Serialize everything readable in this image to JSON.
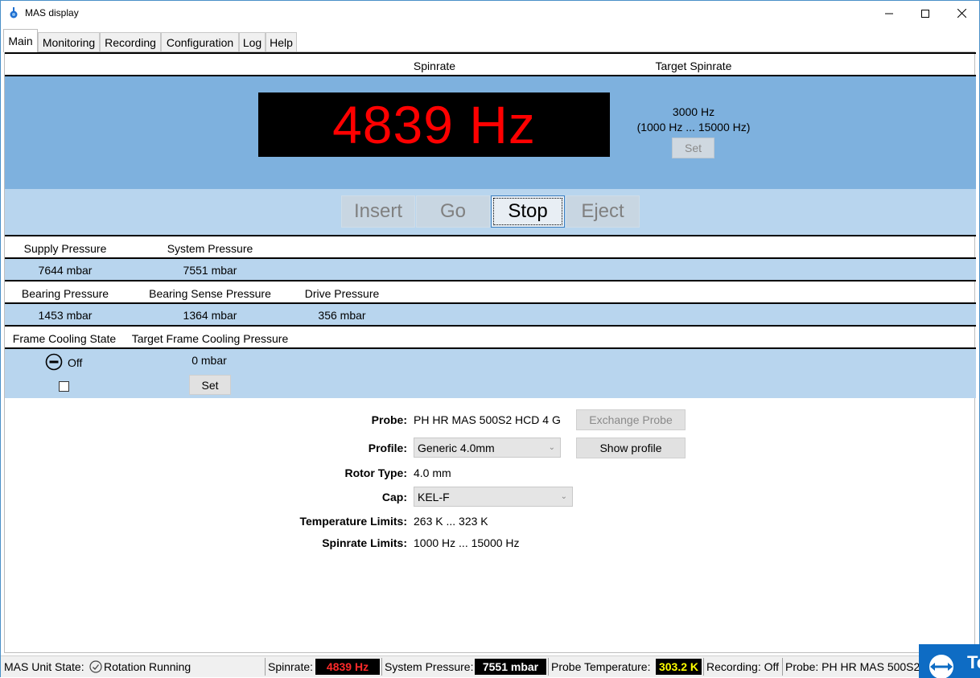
{
  "window": {
    "title": "MAS display"
  },
  "window_controls": {
    "minimize": "─",
    "maximize": "☐",
    "close": "✕"
  },
  "tabs": [
    {
      "label": "Main"
    },
    {
      "label": "Monitoring"
    },
    {
      "label": "Recording"
    },
    {
      "label": "Configuration"
    },
    {
      "label": "Log"
    },
    {
      "label": "Help"
    }
  ],
  "spinrate": {
    "header": "Spinrate",
    "target_header": "Target Spinrate",
    "value": "4839 Hz",
    "target_value": "3000 Hz",
    "target_range": "(1000 Hz ... 15000 Hz)",
    "set_label": "Set"
  },
  "motor_buttons": [
    {
      "label": "Insert",
      "state": "disabled"
    },
    {
      "label": "Go",
      "state": "disabled"
    },
    {
      "label": "Stop",
      "state": "active"
    },
    {
      "label": "Eject",
      "state": "disabled"
    }
  ],
  "pressures_row1": {
    "supply_label": "Supply Pressure",
    "supply_value": "7644 mbar",
    "system_label": "System Pressure",
    "system_value": "7551 mbar"
  },
  "pressures_row2": {
    "bearing_label": "Bearing Pressure",
    "bearing_value": "1453 mbar",
    "bearing_sense_label": "Bearing Sense Pressure",
    "bearing_sense_value": "1364 mbar",
    "drive_label": "Drive Pressure",
    "drive_value": "356 mbar"
  },
  "frame_cooling": {
    "state_label": "Frame Cooling State",
    "state_value": "Off",
    "target_label": "Target Frame Cooling Pressure",
    "target_value": "0 mbar",
    "set_label": "Set",
    "checkbox_checked": false
  },
  "probe_info": {
    "probe_label": "Probe:",
    "probe_value": "PH HR MAS 500S2 HCD 4 G",
    "exchange_button": "Exchange Probe",
    "profile_label": "Profile:",
    "profile_value": "Generic 4.0mm",
    "show_profile_button": "Show profile",
    "rotor_label": "Rotor Type:",
    "rotor_value": "4.0 mm",
    "cap_label": "Cap:",
    "cap_value": "KEL-F",
    "temp_label": "Temperature Limits:",
    "temp_value": "263 K ... 323 K",
    "spin_label": "Spinrate Limits:",
    "spin_value": "1000 Hz ... 15000 Hz"
  },
  "statusbar": {
    "unit_state_label": "MAS Unit State:",
    "unit_state_value": "Rotation Running",
    "spinrate_label": "Spinrate:",
    "spinrate_value": "4839 Hz",
    "system_pressure_label": "System Pressure:",
    "system_pressure_value": "7551 mbar",
    "probe_temp_label": "Probe Temperature:",
    "probe_temp_value": "303.2 K",
    "recording_label": "Recording: Off",
    "probe_label": "Probe: PH HR MAS 500S2",
    "colors": {
      "spinrate": "#ff2a2a",
      "pressure": "#ffffff",
      "temperature": "#ffff00"
    }
  },
  "overlay": {
    "label": "Te"
  },
  "colors": {
    "band_blue": "#7eb1de",
    "band_light": "#b8d5ee",
    "display_red": "#ff0000"
  }
}
